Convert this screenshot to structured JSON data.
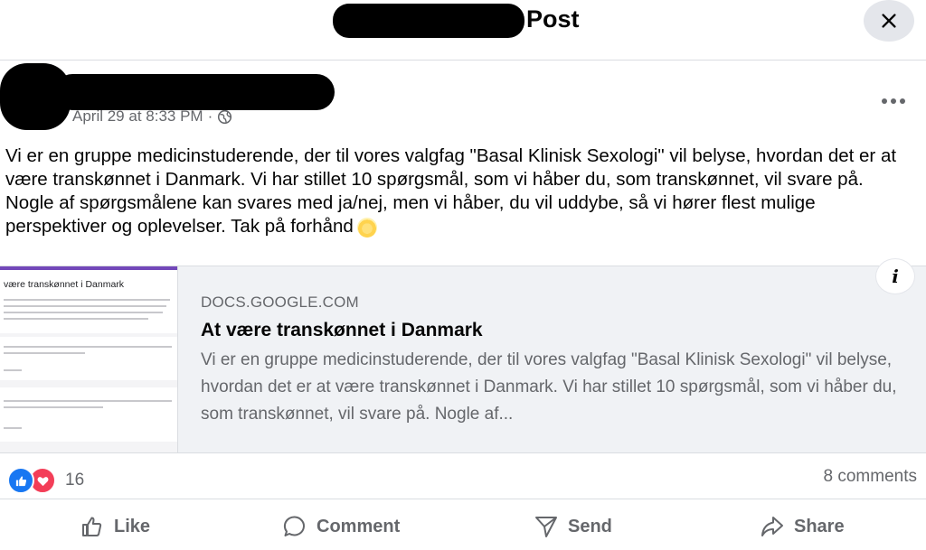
{
  "header": {
    "title": "Post",
    "close_icon": "close-icon"
  },
  "post": {
    "timestamp": "April 29 at 8:33 PM",
    "separator": "·",
    "audience_icon": "globe-icon",
    "more_icon": "more-horizontal-icon",
    "text": "Vi er en gruppe medicinstuderende, der til vores valgfag \"Basal Klinisk Sexologi\" vil belyse, hvordan det er at være transkønnet i Danmark. Vi har stillet 10 spørgsmål, som vi håber du, som transkønnet, vil svare på. Nogle af spørgsmålene kan svares med ja/nej, men vi håber, du vil uddybe, så vi hører flest mulige perspektiver og oplevelser. Tak på forhånd",
    "emoji_icon": "smile-emoji-icon"
  },
  "link_preview": {
    "thumbnail_title": "være transkønnet i Danmark",
    "domain": "DOCS.GOOGLE.COM",
    "title": "At være transkønnet i Danmark",
    "description": "Vi er en gruppe medicinstuderende, der til vores valgfag \"Basal Klinisk Sexologi\" vil belyse, hvordan det er at være transkønnet i Danmark. Vi har stillet 10 spørgsmål, som vi håber du, som transkønnet, vil svare på. Nogle af...",
    "info_icon": "info-icon"
  },
  "reactions": {
    "icons": [
      "like-reaction-icon",
      "love-reaction-icon"
    ],
    "count": "16",
    "comments": "8 comments"
  },
  "actions": {
    "like": "Like",
    "comment": "Comment",
    "send": "Send",
    "share": "Share"
  },
  "colors": {
    "like_blue": "#1877f2",
    "love_red": "#f33e58",
    "secondary_text": "#65676b",
    "card_bg": "#f0f2f5"
  }
}
